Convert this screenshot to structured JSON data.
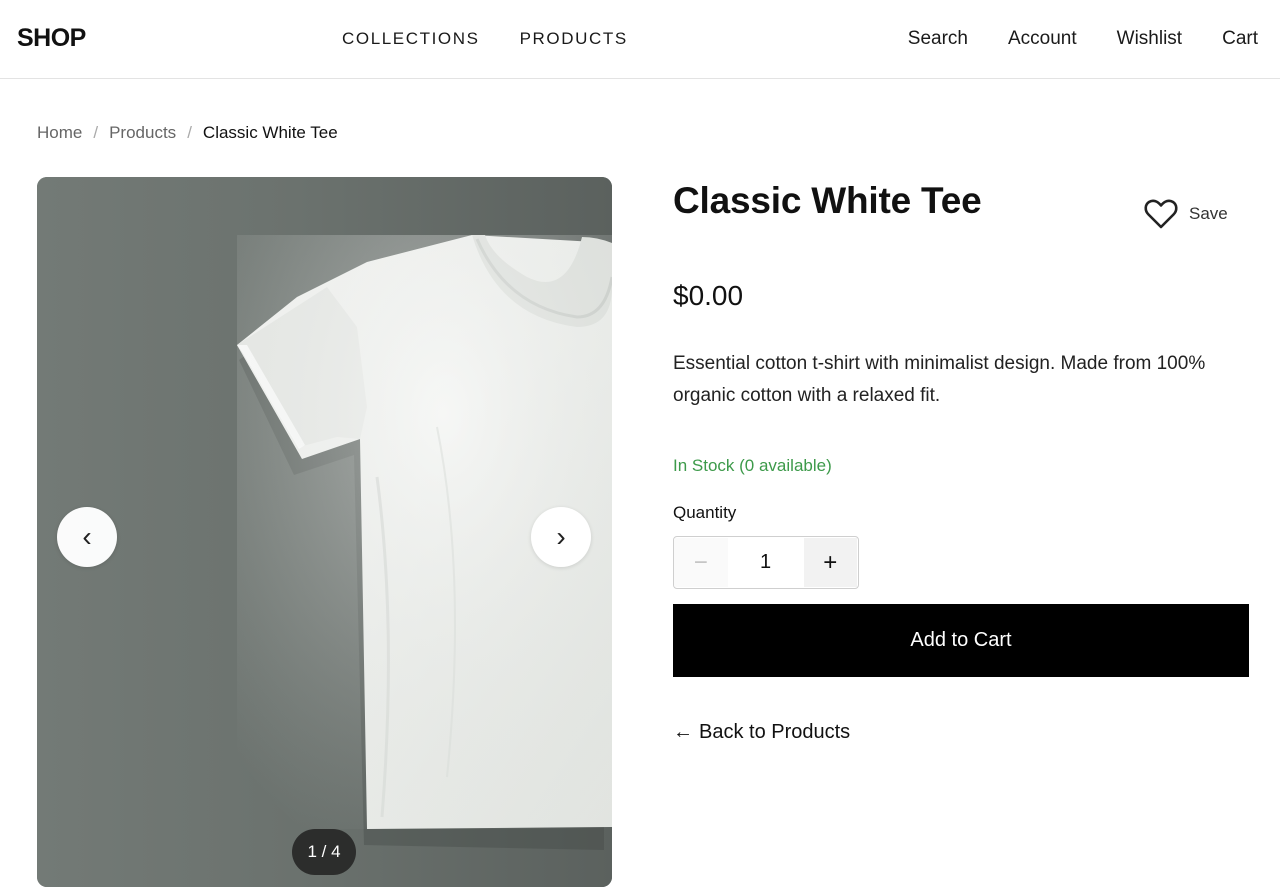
{
  "header": {
    "logo": "SHOP",
    "nav": [
      "COLLECTIONS",
      "PRODUCTS"
    ],
    "actions": [
      "Search",
      "Account",
      "Wishlist",
      "Cart"
    ]
  },
  "breadcrumb": {
    "home": "Home",
    "products": "Products",
    "current": "Classic White Tee",
    "separator": "/"
  },
  "gallery": {
    "prev_icon": "‹",
    "next_icon": "›",
    "counter": "1 / 4",
    "current_image": 1,
    "total_images": 4
  },
  "product": {
    "title": "Classic White Tee",
    "save_label": "Save",
    "price": "$0.00",
    "description": "Essential cotton t-shirt with minimalist design. Made from 100% organic cotton with a relaxed fit.",
    "stock": "In Stock (0 available)",
    "quantity_label": "Quantity",
    "quantity_value": "1",
    "minus": "−",
    "plus": "+",
    "add_to_cart": "Add to Cart",
    "back_label": "Back to Products",
    "back_icon": "←"
  },
  "colors": {
    "stock_green": "#3d9a4a",
    "button_black": "#000000",
    "accent_text": "#111111"
  },
  "icons": [
    "heart-icon",
    "chevron-left-icon",
    "chevron-right-icon",
    "arrow-left-icon"
  ]
}
